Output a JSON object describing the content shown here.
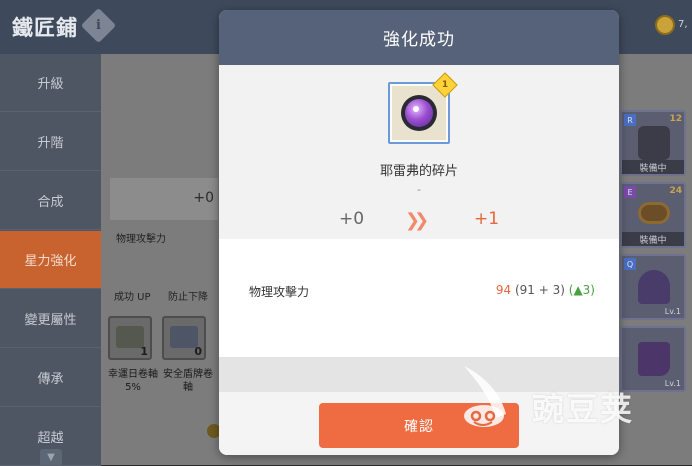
{
  "header": {
    "title": "鐵匠鋪",
    "info_icon": "info-icon",
    "coin_text": "7,"
  },
  "sidebar": {
    "items": [
      {
        "label": "升級",
        "active": false
      },
      {
        "label": "升階",
        "active": false
      },
      {
        "label": "合成",
        "active": false
      },
      {
        "label": "星力強化",
        "active": true
      },
      {
        "label": "變更屬性",
        "active": false
      },
      {
        "label": "傳承",
        "active": false
      },
      {
        "label": "超越",
        "active": false
      }
    ],
    "scroll_icon": "chevron-down-icon"
  },
  "background_panel": {
    "star_level": "+0",
    "attack_label": "物理攻擊力",
    "chance_up": "成功 UP",
    "prevent_down": "防止下降",
    "scrolls": [
      {
        "label_line1": "幸運日卷軸",
        "label_line2": "5%",
        "count": "1"
      },
      {
        "label_line1": "安全盾牌卷",
        "label_line2": "軸",
        "count": "0"
      }
    ]
  },
  "equipment": [
    {
      "tag": "R",
      "level": "12",
      "status": "裝備中",
      "lv": ""
    },
    {
      "tag": "E",
      "level": "24",
      "status": "裝備中",
      "lv": ""
    },
    {
      "tag": "Q",
      "level": "",
      "status": "",
      "lv": "Lv.1"
    },
    {
      "tag": "",
      "level": "",
      "status": "",
      "lv": "Lv.1"
    }
  ],
  "modal": {
    "title": "強化成功",
    "item": {
      "name": "耶雷弗的碎片",
      "subtitle": "-",
      "badge": "1"
    },
    "star_from": "+0",
    "star_to": "+1",
    "stat": {
      "label": "物理攻擊力",
      "new_value": "94",
      "detail": "(91 + 3)",
      "increase": "(▲3)"
    },
    "confirm_label": "確認"
  },
  "watermark": {
    "text": "豌豆荚"
  },
  "colors": {
    "accent": "#ef6b42",
    "header": "#56627a",
    "sidebar_active": "#c8622e",
    "increase": "#48a040"
  }
}
